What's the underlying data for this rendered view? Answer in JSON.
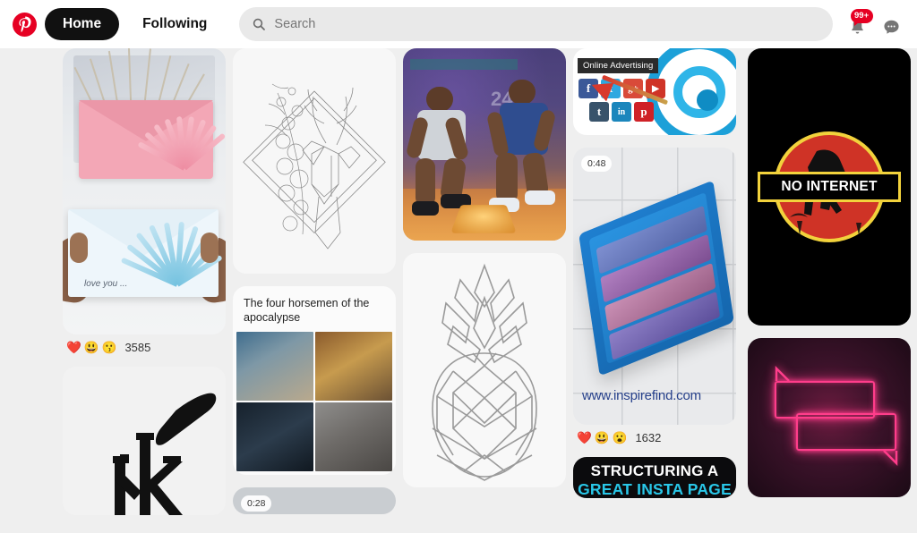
{
  "header": {
    "logo_icon": "pinterest-logo-icon",
    "tabs": [
      {
        "label": "Home",
        "active": true
      },
      {
        "label": "Following",
        "active": false
      }
    ],
    "search": {
      "icon": "search-icon",
      "placeholder": "Search",
      "value": ""
    },
    "notifications": {
      "icon": "bell-icon",
      "badge": "99+",
      "badge_color": "#e60023"
    },
    "messages": {
      "icon": "chat-bubble-icon"
    }
  },
  "theme": {
    "accent": "#e60023",
    "page_background": "#efefef",
    "header_background": "#ffffff",
    "tab_active_background": "#111111"
  },
  "feed": {
    "columns": 5,
    "pins": [
      {
        "id": "pin-envelopes",
        "description": "Pink and blue paper envelopes with folded fan decorations held in hands",
        "handwriting": "love you ...",
        "reactions": {
          "emojis": [
            "❤️",
            "😃",
            "😗"
          ],
          "count": "3585"
        }
      },
      {
        "id": "pin-nike-kyrie",
        "description": "Nike swoosh with Kyrie Irving K logo on light grey background"
      },
      {
        "id": "pin-deer-lineart",
        "description": "Geometric deer head line drawing with floral antlers inside a diamond frame"
      },
      {
        "id": "pin-four-horsemen",
        "title": "The four horsemen of the apocalypse",
        "description": "Two by two meme photo grid"
      },
      {
        "id": "pin-video-028",
        "duration": "0:28",
        "description": "Video pin partially scrolled out of view"
      },
      {
        "id": "pin-basketball",
        "description": "Two basketball players kneeling, purple and orange artwork",
        "jersey_number": "24"
      },
      {
        "id": "pin-pineapple-lineart",
        "description": "Geometric pineapple outline drawing"
      },
      {
        "id": "pin-online-advertising",
        "label": "Online Advertising",
        "description": "Social media icon squares with a dartboard and arrow",
        "social_icons": [
          {
            "name": "facebook-icon",
            "glyph": "f",
            "color": "#3b5998"
          },
          {
            "name": "twitter-icon",
            "glyph": "t",
            "color": "#2fa8e0"
          },
          {
            "name": "googleplus-icon",
            "glyph": "g+",
            "color": "#d94a39"
          },
          {
            "name": "youtube-icon",
            "glyph": "▶",
            "color": "#cf3427"
          },
          {
            "name": "tumblr-icon",
            "glyph": "t",
            "color": "#38536b"
          },
          {
            "name": "linkedin-icon",
            "glyph": "in",
            "color": "#1b86bc"
          },
          {
            "name": "pinterest-icon",
            "glyph": "p",
            "color": "#cf2127"
          }
        ]
      },
      {
        "id": "pin-blue-tray-video",
        "duration": "0:48",
        "watermark": "www.inspirefind.com",
        "description": "Blue plastic tray organizer on a tiled surface",
        "reactions": {
          "emojis": [
            "❤️",
            "😃",
            "😮"
          ],
          "count": "1632"
        }
      },
      {
        "id": "pin-insta-page",
        "line1": "STRUCTURING A",
        "line2": "GREAT INSTA PAGE",
        "line2_color": "#29c7e8"
      },
      {
        "id": "pin-no-internet",
        "label": "NO INTERNET",
        "description": "Jurassic Park style logo with dinosaur silhouette"
      },
      {
        "id": "pin-neon-bubbles",
        "description": "Two neon pink speech bubbles on dark maroon gradient"
      }
    ]
  }
}
